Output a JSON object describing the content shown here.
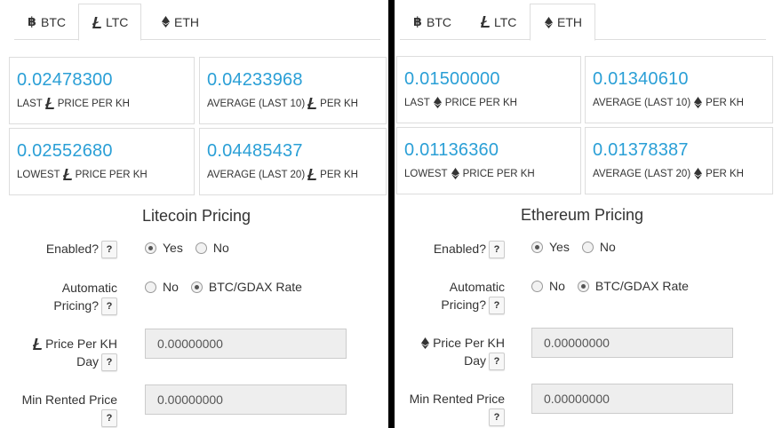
{
  "tabs": [
    {
      "label": "BTC",
      "icon": "bitcoin-icon"
    },
    {
      "label": "LTC",
      "icon": "litecoin-icon"
    },
    {
      "label": "ETH",
      "icon": "ethereum-icon"
    }
  ],
  "ltc": {
    "active_tab": "LTC",
    "stats": {
      "last_price": {
        "value": "0.02478300",
        "label_pre": "LAST",
        "label_post": "PRICE PER KH"
      },
      "avg10": {
        "value": "0.04233968",
        "label_pre": "AVERAGE (LAST 10)",
        "label_post": "PER KH"
      },
      "lowest": {
        "value": "0.02552680",
        "label_pre": "LOWEST",
        "label_post": "PRICE PER KH"
      },
      "avg20": {
        "value": "0.04485437",
        "label_pre": "AVERAGE (LAST 20)",
        "label_post": "PER KH"
      }
    },
    "section_title": "Litecoin Pricing",
    "enabled_label": "Enabled?",
    "enabled_options": [
      "Yes",
      "No"
    ],
    "enabled_selected": "Yes",
    "auto_label_1": "Automatic",
    "auto_label_2": "Pricing?",
    "auto_options": [
      "No",
      "BTC/GDAX Rate"
    ],
    "auto_selected": "BTC/GDAX Rate",
    "price_label_1": "Price Per KH",
    "price_label_2": "Day",
    "price_value": "0.00000000",
    "min_label": "Min Rented Price",
    "min_value": "0.00000000",
    "help": "?"
  },
  "eth": {
    "active_tab": "ETH",
    "stats": {
      "last_price": {
        "value": "0.01500000",
        "label_pre": "LAST",
        "label_post": "PRICE PER KH"
      },
      "avg10": {
        "value": "0.01340610",
        "label_pre": "AVERAGE (LAST 10)",
        "label_post": "PER KH"
      },
      "lowest": {
        "value": "0.01136360",
        "label_pre": "LOWEST",
        "label_post": "PRICE PER KH"
      },
      "avg20": {
        "value": "0.01378387",
        "label_pre": "AVERAGE (LAST 20)",
        "label_post": "PER KH"
      }
    },
    "section_title": "Ethereum Pricing",
    "enabled_label": "Enabled?",
    "enabled_options": [
      "Yes",
      "No"
    ],
    "enabled_selected": "Yes",
    "auto_label_1": "Automatic",
    "auto_label_2": "Pricing?",
    "auto_options": [
      "No",
      "BTC/GDAX Rate"
    ],
    "auto_selected": "BTC/GDAX Rate",
    "price_label_1": "Price Per KH",
    "price_label_2": "Day",
    "price_value": "0.00000000",
    "min_label": "Min Rented Price",
    "min_value": "0.00000000",
    "help": "?"
  },
  "colors": {
    "accent": "#2a9fd6",
    "divider": "#000000",
    "input_bg": "#eeeeee"
  }
}
